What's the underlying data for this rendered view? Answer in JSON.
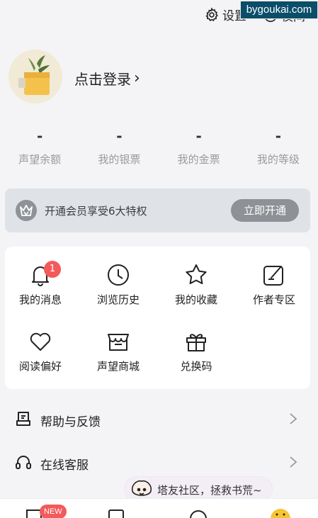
{
  "header": {
    "settings_label": "设置",
    "moon_label": "夜间",
    "watermark": "bygoukai.com"
  },
  "profile": {
    "login_label": "点击登录",
    "login_arrow": "›"
  },
  "stats": [
    {
      "value": "-",
      "label": "声望余额"
    },
    {
      "value": "-",
      "label": "我的银票"
    },
    {
      "value": "-",
      "label": "我的金票"
    },
    {
      "value": "-",
      "label": "我的等级"
    }
  ],
  "vip": {
    "text": "开通会员享受6大特权",
    "button": "立即开通"
  },
  "grid": [
    {
      "label": "我的消息",
      "icon": "bell-icon",
      "badge": "1"
    },
    {
      "label": "浏览历史",
      "icon": "clock-icon"
    },
    {
      "label": "我的收藏",
      "icon": "star-icon"
    },
    {
      "label": "作者专区",
      "icon": "edit-icon"
    },
    {
      "label": "阅读偏好",
      "icon": "heart-icon"
    },
    {
      "label": "声望商城",
      "icon": "store-icon"
    },
    {
      "label": "兑换码",
      "icon": "gift-icon"
    }
  ],
  "list": [
    {
      "label": "帮助与反馈",
      "icon": "feedback-icon"
    },
    {
      "label": "在线客服",
      "icon": "headset-icon"
    }
  ],
  "community": {
    "text": "塔友社区，拯救书荒~"
  },
  "bottom_nav": {
    "new_badge": "NEW"
  }
}
